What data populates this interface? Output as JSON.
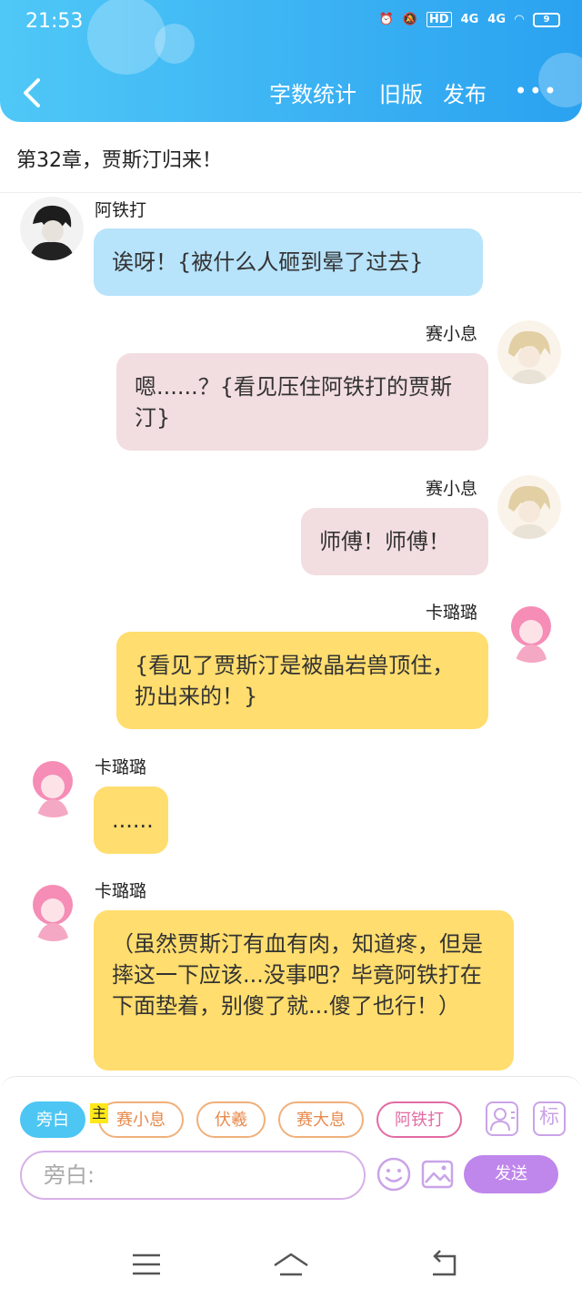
{
  "status_bar": {
    "time": "21:53",
    "network_1": "4G",
    "network_2": "4G",
    "hd_label": "HD",
    "battery": "9"
  },
  "header": {
    "word_count_label": "字数统计",
    "old_version_label": "旧版",
    "publish_label": "发布",
    "more_label": "•••",
    "accent_color": "#3bb2f3"
  },
  "chapter": {
    "title": "第32章，贾斯汀归来！"
  },
  "messages": [
    {
      "sender": "阿铁打",
      "side": "left",
      "color": "blue",
      "text": "诶呀！{被什么人砸到晕了过去}"
    },
    {
      "sender": "赛小息",
      "side": "right",
      "color": "pink",
      "text": "嗯......？{看见压住阿铁打的贾斯汀}"
    },
    {
      "sender": "赛小息",
      "side": "right",
      "color": "pink",
      "text": "师傅！师傅！"
    },
    {
      "sender": "卡璐璐",
      "side": "right",
      "color": "yellow",
      "text": "{看见了贾斯汀是被晶岩兽顶住，扔出来的！}"
    },
    {
      "sender": "卡璐璐",
      "side": "left",
      "color": "yellow",
      "text": "......"
    },
    {
      "sender": "卡璐璐",
      "side": "left",
      "color": "yellow",
      "text": "（虽然贾斯汀有血有肉，知道疼，但是摔这一下应该...没事吧？毕竟阿铁打在下面垫着，别傻了就...傻了也行！）"
    }
  ],
  "toolbar": {
    "roles": [
      "旁白",
      "赛小息",
      "伏羲",
      "赛大息",
      "阿铁打"
    ],
    "master_tag": "主",
    "mark_label": "标",
    "input_placeholder": "旁白:",
    "send_label": "发送"
  }
}
